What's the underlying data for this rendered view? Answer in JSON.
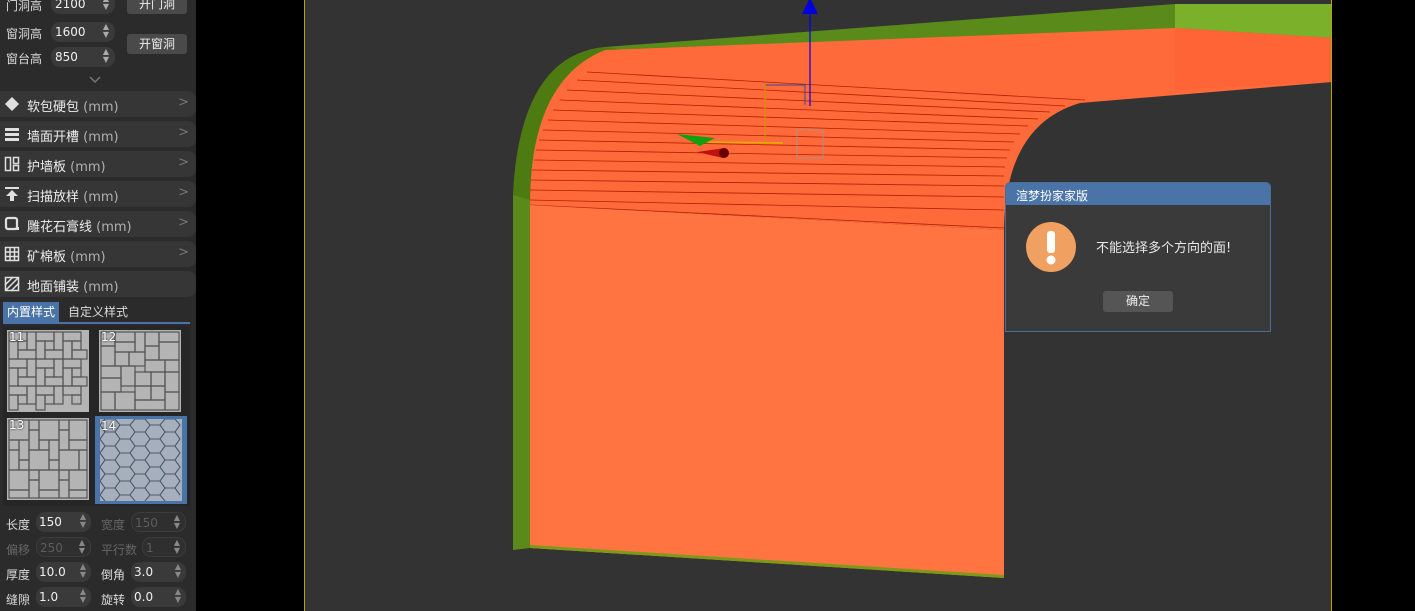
{
  "opening": {
    "door_height": {
      "label": "门洞高",
      "value": "2100",
      "button": "开门洞"
    },
    "window_height": {
      "label": "窗洞高",
      "value": "1600",
      "button": "开窗洞"
    },
    "sill_height": {
      "label": "窗台高",
      "value": "850"
    }
  },
  "sections": [
    {
      "icon": "diamond-icon",
      "title": "软包硬包",
      "unit": "(mm)"
    },
    {
      "icon": "lines-icon",
      "title": "墙面开槽",
      "unit": "(mm)"
    },
    {
      "icon": "panel-icon",
      "title": "护墙板",
      "unit": "(mm)"
    },
    {
      "icon": "sweep-icon",
      "title": "扫描放样",
      "unit": "(mm)"
    },
    {
      "icon": "molding-icon",
      "title": "雕花石膏线",
      "unit": "(mm)"
    },
    {
      "icon": "grid-icon",
      "title": "矿棉板",
      "unit": "(mm)"
    },
    {
      "icon": "hatch-icon",
      "title": "地面铺装",
      "unit": "(mm)"
    }
  ],
  "tabs": [
    {
      "label": "内置样式",
      "active": true
    },
    {
      "label": "自定义样式",
      "active": false
    }
  ],
  "patterns": [
    {
      "num": "11",
      "selected": false
    },
    {
      "num": "12",
      "selected": false
    },
    {
      "num": "13",
      "selected": false
    },
    {
      "num": "14",
      "selected": true
    }
  ],
  "params": {
    "length": {
      "label": "长度",
      "value": "150"
    },
    "width": {
      "label": "宽度",
      "value": "150"
    },
    "offset": {
      "label": "偏移",
      "value": "250"
    },
    "parallel": {
      "label": "平行数",
      "value": "1"
    },
    "thickness": {
      "label": "厚度",
      "value": "10.0"
    },
    "chamfer": {
      "label": "倒角",
      "value": "3.0"
    },
    "gap": {
      "label": "缝隙",
      "value": "1.0"
    },
    "rotate": {
      "label": "旋转",
      "value": "0.0"
    }
  },
  "dialog": {
    "title": "渲梦扮家家版",
    "message": "不能选择多个方向的面!",
    "ok_label": "确定"
  },
  "colors": {
    "accent": "#4a74a8",
    "warning": "#f0a060",
    "face": "#ff7040",
    "wall": "#5a8a1a"
  }
}
